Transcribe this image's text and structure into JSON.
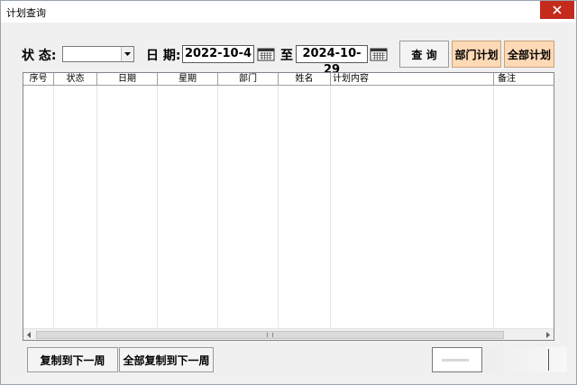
{
  "window": {
    "title": "计划查询"
  },
  "filters": {
    "status_label": "状 态:",
    "status_value": "",
    "date_label": "日 期:",
    "date_from": "2022-10-4",
    "to_label": "至",
    "date_to": "2024-10-29"
  },
  "buttons": {
    "query": "查 询",
    "dept_plan": "部门计划",
    "all_plan": "全部计划",
    "copy_next_week": "复制到下一周",
    "copy_all_next_week": "全部复制到下一周",
    "ok": ""
  },
  "table": {
    "columns": [
      "序号",
      "状态",
      "日期",
      "星期",
      "部门",
      "姓名",
      "计划内容",
      "备注"
    ],
    "rows": []
  },
  "colors": {
    "accent_button": "#fdd9b5",
    "close": "#c42b1c"
  }
}
